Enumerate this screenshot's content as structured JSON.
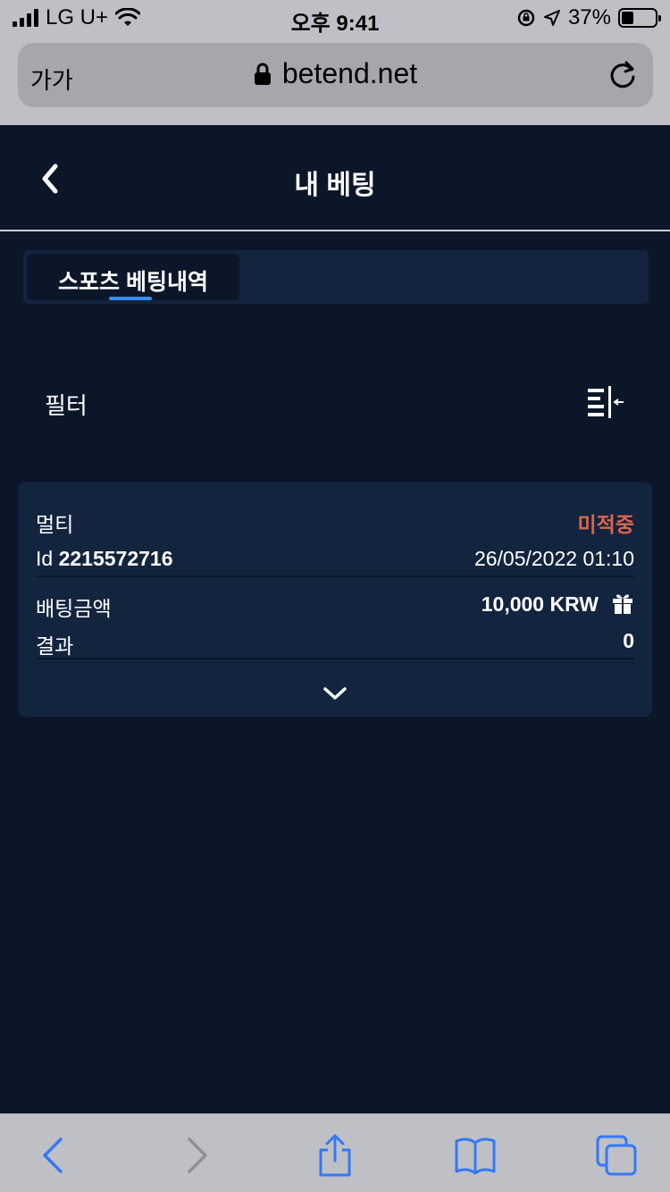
{
  "status_bar": {
    "carrier": "LG U+",
    "time": "오후 9:41",
    "battery_percent": "37%",
    "battery_level": 0.37
  },
  "browser": {
    "text_size_label": "가가",
    "url": "betend.net"
  },
  "header": {
    "title": "내 베팅"
  },
  "tabs": [
    {
      "label": "스포츠 베팅내역",
      "active": true
    }
  ],
  "filter": {
    "label": "필터"
  },
  "bet": {
    "type": "멀티",
    "status": "미적중",
    "id_prefix": "Id",
    "id": "2215572716",
    "datetime": "26/05/2022 01:10",
    "amount_label": "배팅금액",
    "amount": "10,000 KRW",
    "result_label": "결과",
    "result": "0"
  },
  "colors": {
    "background": "#0b1729",
    "card": "#13243f",
    "status_lost": "#d9654e",
    "accent": "#3d8cf0",
    "browser_chrome": "#bfc0c5",
    "toolbar_icon": "#3478f6"
  },
  "icons": {
    "back": "chevron-left-icon",
    "filter": "filter-collapse-icon",
    "gift": "gift-icon",
    "expand": "chevron-down-icon",
    "lock": "lock-icon",
    "reload": "reload-icon",
    "share": "share-icon",
    "bookmarks": "book-icon",
    "tabs": "tabs-icon"
  }
}
